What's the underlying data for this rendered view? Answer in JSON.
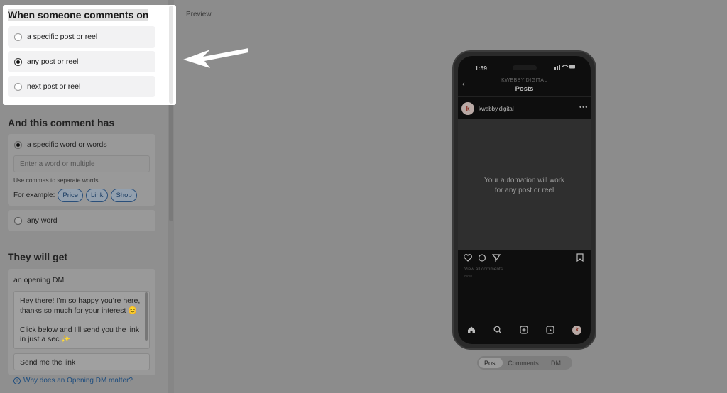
{
  "trigger": {
    "title": "When someone comments on",
    "options": [
      {
        "label": "a specific post or reel",
        "selected": false
      },
      {
        "label": "any post or reel",
        "selected": true
      },
      {
        "label": "next post or reel",
        "selected": false
      }
    ]
  },
  "comment": {
    "title": "And this comment has",
    "specific_label": "a specific word or words",
    "input_placeholder": "Enter a word or multiple",
    "hint": "Use commas to separate words",
    "example_label": "For example:",
    "examples": [
      "Price",
      "Link",
      "Shop"
    ],
    "any_label": "any word"
  },
  "reward": {
    "title": "They will get",
    "dm_title": "an opening DM",
    "dm_text": "Hey there! I’m so happy you’re here, thanks so much for your interest 😊\n\nClick below and I’ll send you the link in just a sec ✨",
    "button_text": "Send me the link",
    "help_link": "Why does an Opening DM matter?"
  },
  "preview": {
    "label": "Preview",
    "time": "1:59",
    "account_small": "KWEBBY.DIGITAL",
    "screen_title": "Posts",
    "account_name": "kwebby.digital",
    "avatar_letter": "k",
    "message": "Your automation will work\nfor any post or reel",
    "view_comments": "View all comments",
    "now": "Now",
    "tabs": [
      "Post",
      "Comments",
      "DM"
    ],
    "active_tab": "Post"
  },
  "icons": [
    "back-icon",
    "more-icon",
    "heart-icon",
    "comment-icon",
    "share-icon",
    "bookmark-icon",
    "home-icon",
    "search-icon",
    "add-icon",
    "reels-icon",
    "info-icon",
    "arrow-pointer-icon"
  ]
}
